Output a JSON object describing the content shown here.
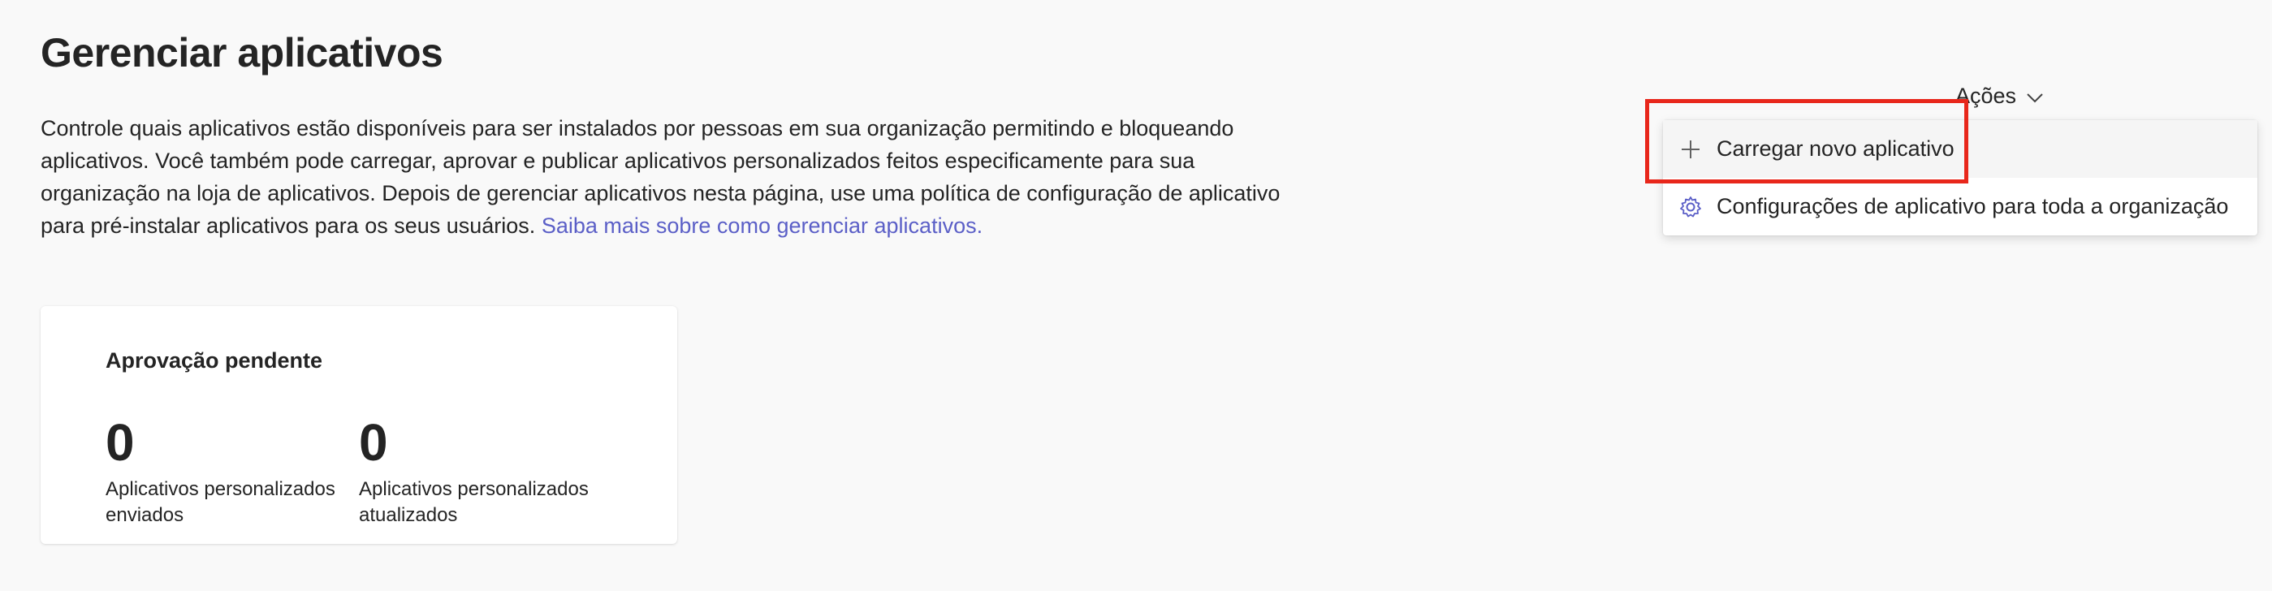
{
  "page": {
    "title": "Gerenciar aplicativos",
    "description": "Controle quais aplicativos estão disponíveis para ser instalados por pessoas em sua organização permitindo e bloqueando aplicativos. Você também pode carregar, aprovar e publicar aplicativos personalizados feitos especificamente para sua organização na loja de aplicativos. Depois de gerenciar aplicativos nesta página, use uma política de configuração de aplicativo para pré-instalar aplicativos para os seus usuários.",
    "learn_more_link": "Saiba mais sobre como gerenciar aplicativos."
  },
  "pending_card": {
    "title": "Aprovação pendente",
    "stats": [
      {
        "value": "0",
        "label": "Aplicativos personalizados enviados"
      },
      {
        "value": "0",
        "label": "Aplicativos personalizados atualizados"
      }
    ]
  },
  "actions": {
    "label": "Ações",
    "chevron_icon": "chevron-down-icon",
    "menu": [
      {
        "label": "Carregar novo aplicativo",
        "icon": "plus-icon",
        "highlighted": true
      },
      {
        "label": "Configurações de aplicativo para toda a organização",
        "icon": "gear-icon",
        "highlighted": false
      }
    ]
  },
  "colors": {
    "background": "#f9f9f9",
    "link": "#5b5fc7",
    "highlight_box": "#e8271b",
    "card": "#ffffff",
    "menu_hover": "#f5f5f5"
  }
}
